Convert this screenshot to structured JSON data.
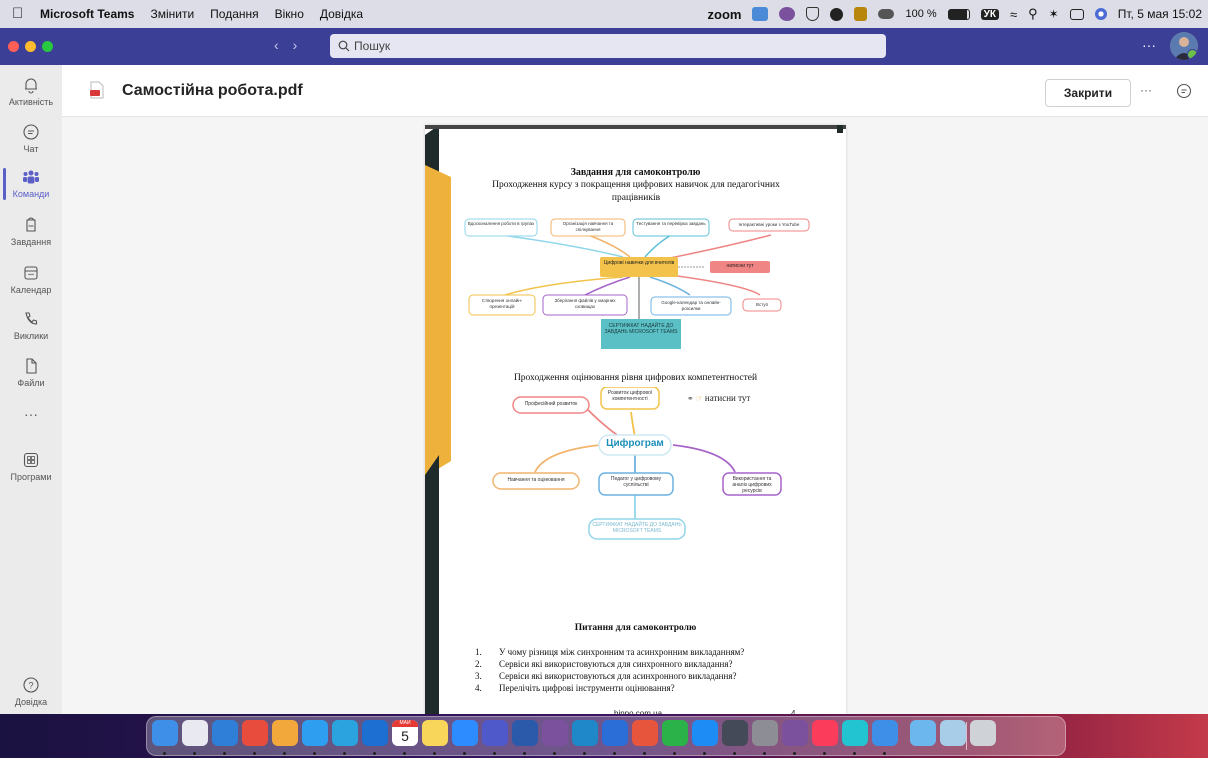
{
  "menubar": {
    "app_name": "Microsoft Teams",
    "menus": [
      "Змінити",
      "Подання",
      "Вікно",
      "Довідка"
    ],
    "zoom_label": "zoom",
    "battery": "100 %",
    "keyboard_lang": "УК",
    "datetime": "Пт, 5 мая  15:02"
  },
  "titlebar": {
    "search_placeholder": "Пошук",
    "more": "···"
  },
  "rail": {
    "items": [
      {
        "label": "Активність",
        "icon": "bell-icon"
      },
      {
        "label": "Чат",
        "icon": "chat-icon"
      },
      {
        "label": "Команди",
        "icon": "teams-icon",
        "active": true
      },
      {
        "label": "Завдання",
        "icon": "assignments-icon"
      },
      {
        "label": "Календар",
        "icon": "calendar-icon"
      },
      {
        "label": "Виклики",
        "icon": "phone-icon"
      },
      {
        "label": "Файли",
        "icon": "file-icon"
      }
    ],
    "more": "···",
    "apps_label": "Програми",
    "help_label": "Довідка"
  },
  "file": {
    "title": "Самостійна робота.pdf",
    "close_label": "Закрити",
    "more": "···"
  },
  "document": {
    "heading1": "Завдання для самоконтролю",
    "heading1_sub": "Проходження курсу з покращення цифрових навичок для педагогічних працівників",
    "map1": {
      "top_nodes": [
        "Вдосконалення роботи в групах",
        "Організація навчання та спілкування",
        "Тестування та перевірка завдань",
        "Інтерактивні уроки з YouTube"
      ],
      "center": "Цифрові навички для вчителів",
      "click": "натисни тут",
      "bottom_nodes": [
        "Створення онлайн-презентацій",
        "Зберігання файлів у хмарних сховищах",
        "Google-календар та онлайн-розсилки",
        "Вступ"
      ],
      "certificate": "СЕРТИФІКАТ НАДАЙТЕ ДО ЗАВДАНЬ MICROSOFT TEAMS"
    },
    "heading2": "Проходження оцінювання рівня цифрових компетентностей",
    "map2": {
      "node_left": "Професійний розвиток",
      "node_top": "Розвиток цифрової компетентності",
      "click": "натисни тут",
      "center": "Цифрограм",
      "bottom_nodes": [
        "Навчання та оцінювання",
        "Педагог у цифровому суспільстві",
        "Використання та аналіз цифрових ресурсів"
      ],
      "certificate": "СЕРТИФІКАТ НАДАЙТЕ ДО ЗАВДАНЬ MICROSOFT TEAMS"
    },
    "heading3": "Питання для самоконтролю",
    "questions": [
      {
        "num": "1.",
        "text": "У чому різниця між синхронним та асинхронним викладанням?"
      },
      {
        "num": "2.",
        "text": "Сервіси які використовуються для синхронного викладання?"
      },
      {
        "num": "3.",
        "text": "Сервіси які використовуються для асинхронного викладання?"
      },
      {
        "num": "4.",
        "text": "Перелічіть цифрові інструменти оцінювання?"
      }
    ],
    "footer_site": "binpo.com.ua",
    "page_number": "4"
  },
  "dock": {
    "calendar_month": "МАЙ",
    "calendar_day": "5",
    "app_icons": [
      "finder-icon",
      "launchpad-icon",
      "safari-icon",
      "chrome-icon",
      "photos-icon",
      "mail-icon",
      "telegram-icon",
      "app-store-like-icon",
      "calendar-icon",
      "notes-icon",
      "zoom-icon",
      "teams-icon",
      "word-icon",
      "viber-icon",
      "edge-icon",
      "keynote-icon",
      "figma-icon",
      "whatsapp-icon",
      "appstore-icon",
      "photo-app-icon",
      "system-prefs-icon",
      "viber-icon",
      "music-icon",
      "canva-icon",
      "preview-icon",
      "folder-icon",
      "downloads-icon",
      "trash-icon"
    ]
  }
}
